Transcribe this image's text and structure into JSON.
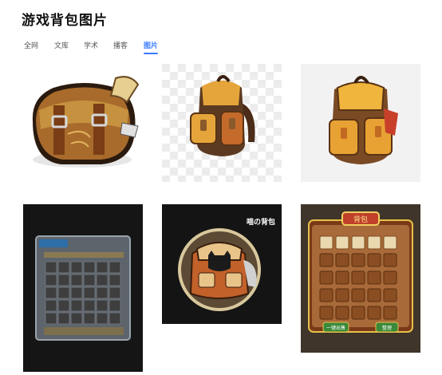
{
  "header": {
    "title": "游戏背包图片"
  },
  "tabs": [
    {
      "label": "全网"
    },
    {
      "label": "文库"
    },
    {
      "label": "学术"
    },
    {
      "label": "播客"
    },
    {
      "label": "图片",
      "active": true
    }
  ],
  "results": [
    {
      "icon": "leather-satchel-image"
    },
    {
      "icon": "orange-backpack-image"
    },
    {
      "icon": "yellow-backpack-image"
    },
    {
      "icon": "inventory-grid-image"
    },
    {
      "icon": "cat-backpack-image",
      "caption": "喵の背包"
    },
    {
      "icon": "game-bag-panel-image",
      "panel_title": "背包",
      "panel_button_left": "一键出售",
      "panel_button_right": "整理"
    }
  ],
  "colors": {
    "accent": "#3a7bff"
  }
}
